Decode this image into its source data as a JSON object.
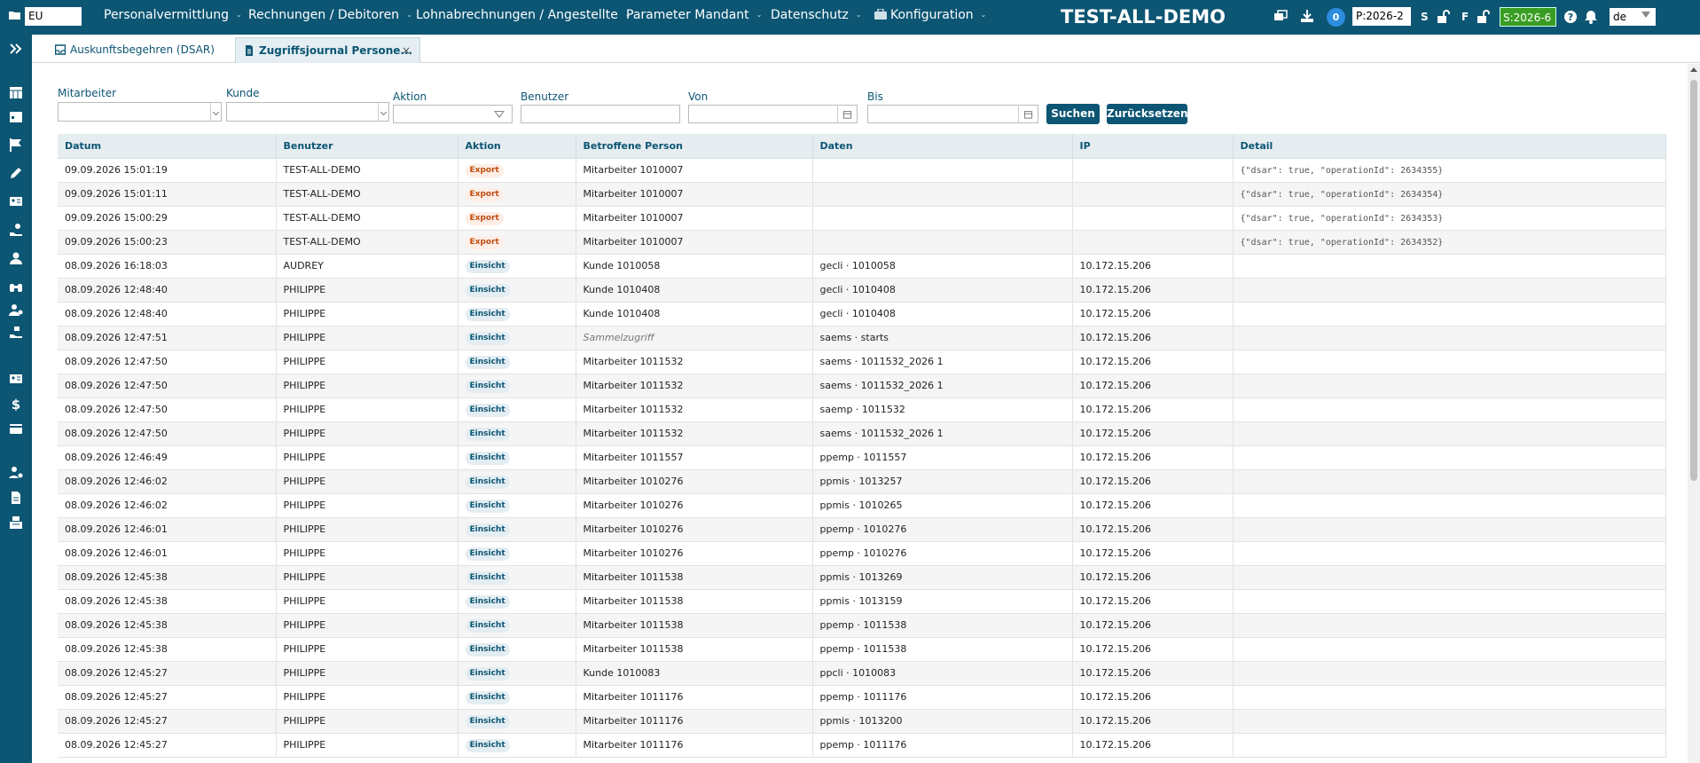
{
  "topbar": {
    "eu_value": "EU",
    "menus": [
      {
        "label": "Personalvermittlung"
      },
      {
        "label": "Rechnungen / Debitoren"
      },
      {
        "label": "Lohnabrechnungen / Angestellte"
      },
      {
        "label": "Parameter Mandant"
      },
      {
        "label": "Datenschutz"
      },
      {
        "label": "Konfiguration"
      }
    ],
    "title": "TEST-ALL-DEMO",
    "notification_count": "0",
    "period": "P:2026-2",
    "letter_s": "S",
    "letter_f": "F",
    "s_period": "S:2026-6",
    "language": "de",
    "colors": {
      "bar": "#0c5573",
      "s_period_bg": "#3a9d23",
      "badge": "#2d8ce0"
    }
  },
  "tabs": [
    {
      "label": "Auskunftsbegehren (DSAR)",
      "icon": "inbox-icon"
    },
    {
      "label": "Zugriffsjournal Persone...",
      "icon": "document-icon",
      "close": "×"
    }
  ],
  "filters": {
    "mitarbeiter_label": "Mitarbeiter",
    "kunde_label": "Kunde",
    "aktion_label": "Aktion",
    "benutzer_label": "Benutzer",
    "von_label": "Von",
    "bis_label": "Bis",
    "search_button": "Suchen",
    "reset_button": "Zurücksetzen"
  },
  "table": {
    "columns": [
      "Datum",
      "Benutzer",
      "Aktion",
      "Betroffene Person",
      "Daten",
      "IP",
      "Detail"
    ],
    "rows": [
      [
        "09.09.2026 15:01:19",
        "TEST-ALL-DEMO",
        "Export",
        "Mitarbeiter 1010007",
        "",
        "",
        "{\"dsar\": true, \"operationId\": 2634355}"
      ],
      [
        "09.09.2026 15:01:11",
        "TEST-ALL-DEMO",
        "Export",
        "Mitarbeiter 1010007",
        "",
        "",
        "{\"dsar\": true, \"operationId\": 2634354}"
      ],
      [
        "09.09.2026 15:00:29",
        "TEST-ALL-DEMO",
        "Export",
        "Mitarbeiter 1010007",
        "",
        "",
        "{\"dsar\": true, \"operationId\": 2634353}"
      ],
      [
        "09.09.2026 15:00:23",
        "TEST-ALL-DEMO",
        "Export",
        "Mitarbeiter 1010007",
        "",
        "",
        "{\"dsar\": true, \"operationId\": 2634352}"
      ],
      [
        "08.09.2026 16:18:03",
        "AUDREY",
        "Einsicht",
        "Kunde 1010058",
        "gecli · 1010058",
        "10.172.15.206",
        ""
      ],
      [
        "08.09.2026 12:48:40",
        "PHILIPPE",
        "Einsicht",
        "Kunde 1010408",
        "gecli · 1010408",
        "10.172.15.206",
        ""
      ],
      [
        "08.09.2026 12:48:40",
        "PHILIPPE",
        "Einsicht",
        "Kunde 1010408",
        "gecli · 1010408",
        "10.172.15.206",
        ""
      ],
      [
        "08.09.2026 12:47:51",
        "PHILIPPE",
        "Einsicht",
        "Sammelzugriff",
        "saems · starts",
        "10.172.15.206",
        ""
      ],
      [
        "08.09.2026 12:47:50",
        "PHILIPPE",
        "Einsicht",
        "Mitarbeiter 1011532",
        "saems · 1011532_2026 1",
        "10.172.15.206",
        ""
      ],
      [
        "08.09.2026 12:47:50",
        "PHILIPPE",
        "Einsicht",
        "Mitarbeiter 1011532",
        "saems · 1011532_2026 1",
        "10.172.15.206",
        ""
      ],
      [
        "08.09.2026 12:47:50",
        "PHILIPPE",
        "Einsicht",
        "Mitarbeiter 1011532",
        "saemp · 1011532",
        "10.172.15.206",
        ""
      ],
      [
        "08.09.2026 12:47:50",
        "PHILIPPE",
        "Einsicht",
        "Mitarbeiter 1011532",
        "saems · 1011532_2026 1",
        "10.172.15.206",
        ""
      ],
      [
        "08.09.2026 12:46:49",
        "PHILIPPE",
        "Einsicht",
        "Mitarbeiter 1011557",
        "ppemp · 1011557",
        "10.172.15.206",
        ""
      ],
      [
        "08.09.2026 12:46:02",
        "PHILIPPE",
        "Einsicht",
        "Mitarbeiter 1010276",
        "ppmis · 1013257",
        "10.172.15.206",
        ""
      ],
      [
        "08.09.2026 12:46:02",
        "PHILIPPE",
        "Einsicht",
        "Mitarbeiter 1010276",
        "ppmis · 1010265",
        "10.172.15.206",
        ""
      ],
      [
        "08.09.2026 12:46:01",
        "PHILIPPE",
        "Einsicht",
        "Mitarbeiter 1010276",
        "ppemp · 1010276",
        "10.172.15.206",
        ""
      ],
      [
        "08.09.2026 12:46:01",
        "PHILIPPE",
        "Einsicht",
        "Mitarbeiter 1010276",
        "ppemp · 1010276",
        "10.172.15.206",
        ""
      ],
      [
        "08.09.2026 12:45:38",
        "PHILIPPE",
        "Einsicht",
        "Mitarbeiter 1011538",
        "ppmis · 1013269",
        "10.172.15.206",
        ""
      ],
      [
        "08.09.2026 12:45:38",
        "PHILIPPE",
        "Einsicht",
        "Mitarbeiter 1011538",
        "ppmis · 1013159",
        "10.172.15.206",
        ""
      ],
      [
        "08.09.2026 12:45:38",
        "PHILIPPE",
        "Einsicht",
        "Mitarbeiter 1011538",
        "ppemp · 1011538",
        "10.172.15.206",
        ""
      ],
      [
        "08.09.2026 12:45:38",
        "PHILIPPE",
        "Einsicht",
        "Mitarbeiter 1011538",
        "ppemp · 1011538",
        "10.172.15.206",
        ""
      ],
      [
        "08.09.2026 12:45:27",
        "PHILIPPE",
        "Einsicht",
        "Kunde 1010083",
        "ppcli · 1010083",
        "10.172.15.206",
        ""
      ],
      [
        "08.09.2026 12:45:27",
        "PHILIPPE",
        "Einsicht",
        "Mitarbeiter 1011176",
        "ppemp · 1011176",
        "10.172.15.206",
        ""
      ],
      [
        "08.09.2026 12:45:27",
        "PHILIPPE",
        "Einsicht",
        "Mitarbeiter 1011176",
        "ppmis · 1013200",
        "10.172.15.206",
        ""
      ],
      [
        "08.09.2026 12:45:27",
        "PHILIPPE",
        "Einsicht",
        "Mitarbeiter 1011176",
        "ppemp · 1011176",
        "10.172.15.206",
        ""
      ]
    ],
    "italic_values": [
      "Sammelzugriff"
    ]
  }
}
